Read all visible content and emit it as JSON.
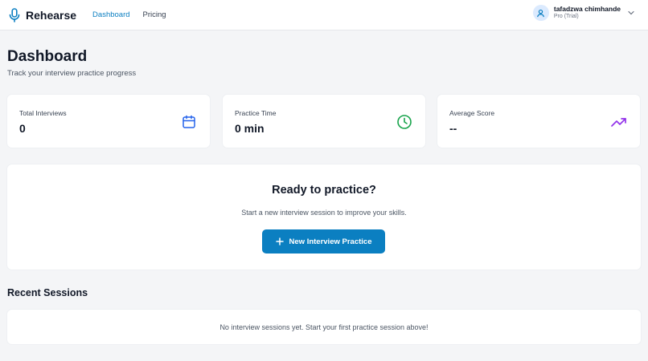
{
  "app": {
    "name": "Rehearse",
    "accent": "#0b7fc1"
  },
  "nav": [
    {
      "label": "Dashboard",
      "active": true
    },
    {
      "label": "Pricing",
      "active": false
    }
  ],
  "user": {
    "name": "tafadzwa chimhande",
    "plan": "Pro (Trial)"
  },
  "header": {
    "title": "Dashboard",
    "subtitle": "Track your interview practice progress"
  },
  "stats": [
    {
      "label": "Total Interviews",
      "value": "0",
      "icon": "calendar-icon",
      "color": "#2563eb"
    },
    {
      "label": "Practice Time",
      "value": "0 min",
      "icon": "clock-icon",
      "color": "#16a34a"
    },
    {
      "label": "Average Score",
      "value": "--",
      "icon": "trending-up-icon",
      "color": "#9333ea"
    }
  ],
  "cta": {
    "title": "Ready to practice?",
    "subtitle": "Start a new interview session to improve your skills.",
    "button_label": "New Interview Practice"
  },
  "recent": {
    "title": "Recent Sessions",
    "empty_text": "No interview sessions yet. Start your first practice session above!"
  }
}
